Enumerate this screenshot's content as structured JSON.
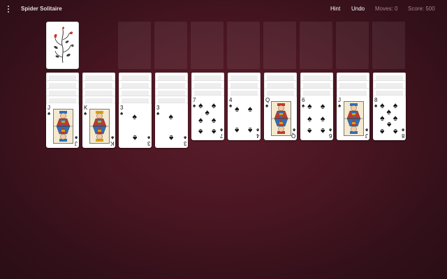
{
  "app": {
    "title": "Spider Solitaire"
  },
  "toolbar": {
    "hint_label": "Hint",
    "undo_label": "Undo",
    "moves_text": "Moves: 0",
    "score_text": "Score: 500"
  },
  "colors": {
    "background": "#4a1622",
    "card": "#ffffff",
    "suit": "#111111"
  },
  "stock": {
    "icon": "decorative-floral-card-back"
  },
  "foundations": 8,
  "columns": [
    {
      "hidden": 4,
      "card": {
        "rank": "J",
        "suit": "♠"
      }
    },
    {
      "hidden": 4,
      "card": {
        "rank": "K",
        "suit": "♠"
      }
    },
    {
      "hidden": 4,
      "card": {
        "rank": "3",
        "suit": "♠"
      }
    },
    {
      "hidden": 4,
      "card": {
        "rank": "3",
        "suit": "♠"
      }
    },
    {
      "hidden": 3,
      "card": {
        "rank": "7",
        "suit": "♠"
      }
    },
    {
      "hidden": 3,
      "card": {
        "rank": "4",
        "suit": "♠"
      }
    },
    {
      "hidden": 3,
      "card": {
        "rank": "Q",
        "suit": "♠"
      }
    },
    {
      "hidden": 3,
      "card": {
        "rank": "6",
        "suit": "♠"
      }
    },
    {
      "hidden": 3,
      "card": {
        "rank": "J",
        "suit": "♠"
      }
    },
    {
      "hidden": 3,
      "card": {
        "rank": "8",
        "suit": "♠"
      }
    }
  ]
}
